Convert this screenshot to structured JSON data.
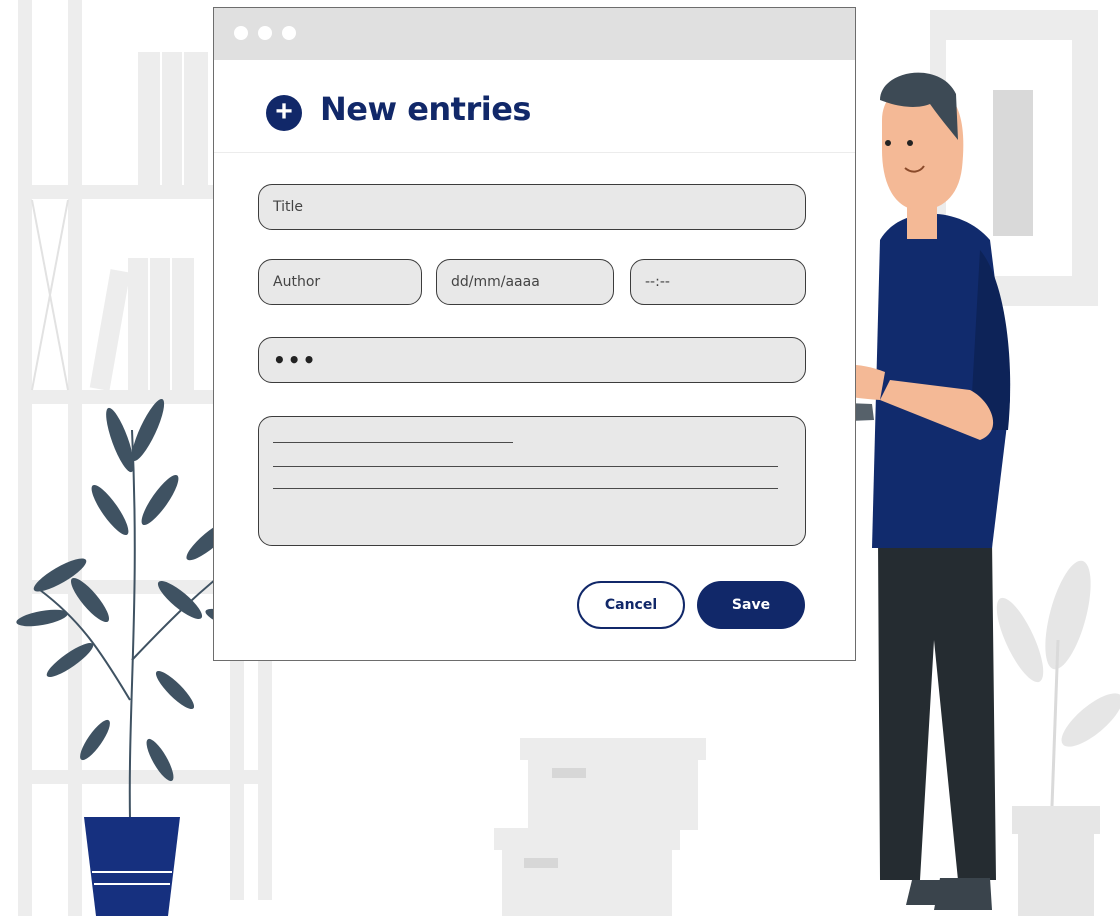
{
  "window": {
    "dots": [
      "dot-1",
      "dot-2",
      "dot-3"
    ],
    "header": {
      "icon": "plus-icon",
      "title": "New entries"
    },
    "fields": {
      "title_placeholder": "Title",
      "author_placeholder": "Author",
      "date_placeholder": "dd/mm/aaaa",
      "time_placeholder": "--:--",
      "password_value": "•••"
    },
    "buttons": {
      "cancel_label": "Cancel",
      "save_label": "Save"
    }
  },
  "colors": {
    "brand": "#112869",
    "field_bg": "#e8e8e8",
    "titlebar": "#e0e0e0",
    "plant_leaf": "#3f5262",
    "pot": "#16307f"
  }
}
